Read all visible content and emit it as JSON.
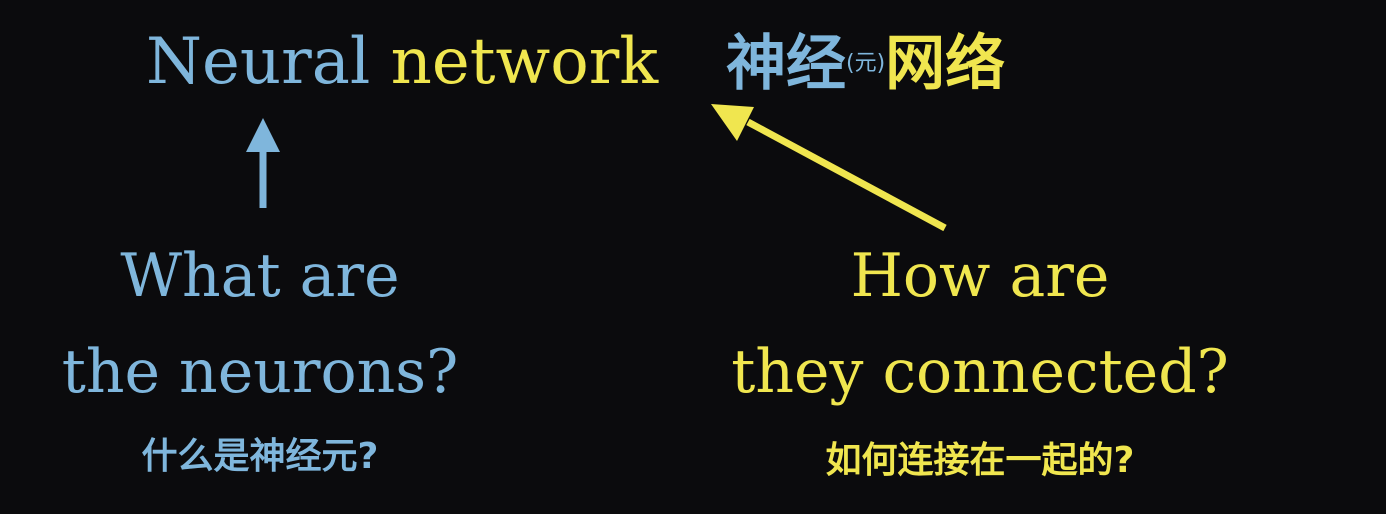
{
  "title": {
    "word_neural": "Neural",
    "word_network": "network",
    "cn_part1": "神经",
    "cn_small": "(元)",
    "cn_part2": "网络"
  },
  "left_question": {
    "line1": "What are",
    "line2": "the neurons?",
    "cn": "什么是神经元?"
  },
  "right_question": {
    "line1": "How are",
    "line2": "they connected?",
    "cn": "如何连接在一起的?"
  },
  "colors": {
    "background": "#0b0b0d",
    "blue": "#7fb6dc",
    "yellow": "#f0e64f"
  }
}
